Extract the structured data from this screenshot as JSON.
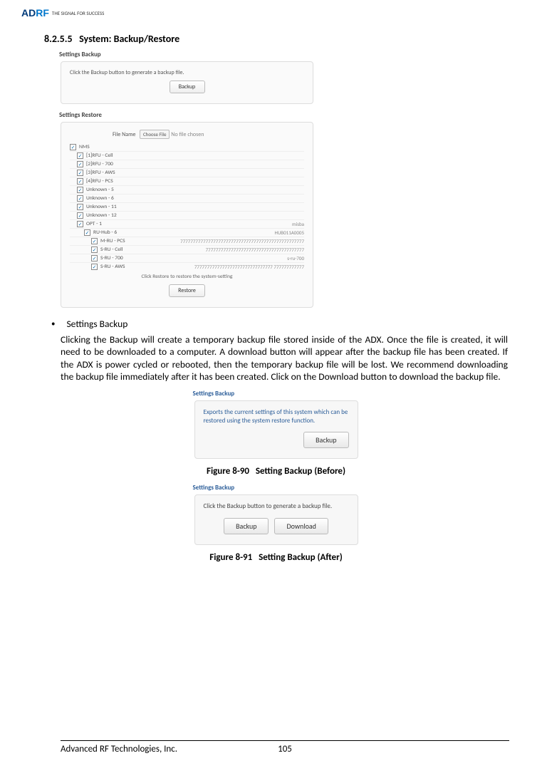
{
  "header": {
    "brand_prefix": "AD",
    "brand_suffix": "RF",
    "tagline": "THE SIGNAL FOR SUCCESS"
  },
  "section": {
    "number": "8.2.5.5",
    "title": "System: Backup/Restore"
  },
  "screenshot1": {
    "backup": {
      "title": "Settings Backup",
      "text": "Click the Backup button to generate a backup file.",
      "btn": "Backup"
    },
    "restore": {
      "title": "Settings Restore",
      "filename_label": "File Name",
      "choose": "Choose File",
      "nofile": "No file chosen",
      "tree": [
        {
          "indent": 0,
          "label": "NMS",
          "val": ""
        },
        {
          "indent": 1,
          "label": "[1]RFU - Cell",
          "val": ""
        },
        {
          "indent": 1,
          "label": "[2]RFU - 700",
          "val": ""
        },
        {
          "indent": 1,
          "label": "[3]RFU - AWS",
          "val": ""
        },
        {
          "indent": 1,
          "label": "[4]RFU - PCS",
          "val": ""
        },
        {
          "indent": 1,
          "label": "Unknown - 5",
          "val": ""
        },
        {
          "indent": 1,
          "label": "Unknown - 6",
          "val": ""
        },
        {
          "indent": 1,
          "label": "Unknown - 11",
          "val": ""
        },
        {
          "indent": 1,
          "label": "Unknown - 12",
          "val": ""
        },
        {
          "indent": 1,
          "label": "OPT - 1",
          "val": "misba"
        },
        {
          "indent": 2,
          "label": "RU-Hub - 6",
          "val": "HUB011A0005"
        },
        {
          "indent": 3,
          "label": "M-RU - PCS",
          "val": "7777777777777777777777777777777777777777777777777"
        },
        {
          "indent": 3,
          "label": "S-RU - Cell",
          "val": "777777777777777777777777777777777777777"
        },
        {
          "indent": 3,
          "label": "S-RU - 700",
          "val": "s-ru-700"
        },
        {
          "indent": 3,
          "label": "S-RU - AWS",
          "val": "7777777777777777777777777777777  777777777777"
        }
      ],
      "note": "Click Restore to restore the system-setting",
      "btn": "Restore"
    }
  },
  "body": {
    "bullet": "Settings Backup",
    "para": "Clicking the Backup will create a temporary backup file stored inside of the ADX.  Once the file is created, it will need to be downloaded to a computer.  A download button will appear after the backup file has been created.  If the ADX is power cycled or rebooted, then the temporary backup file will be lost.  We recommend downloading the backup file immediately after it has been created.  Click on the Download button to download the backup file."
  },
  "fig2": {
    "title": "Settings Backup",
    "text": "Exports the current settings of this system which can be restored using the system restore function.",
    "btn": "Backup",
    "caption_num": "Figure 8-90",
    "caption_txt": "Setting Backup (Before)"
  },
  "fig3": {
    "title": "Settings Backup",
    "text": "Click the Backup button to generate a backup file.",
    "btn1": "Backup",
    "btn2": "Download",
    "caption_num": "Figure 8-91",
    "caption_txt": "Setting Backup (After)"
  },
  "footer": {
    "company": "Advanced RF Technologies, Inc.",
    "page": "105"
  }
}
